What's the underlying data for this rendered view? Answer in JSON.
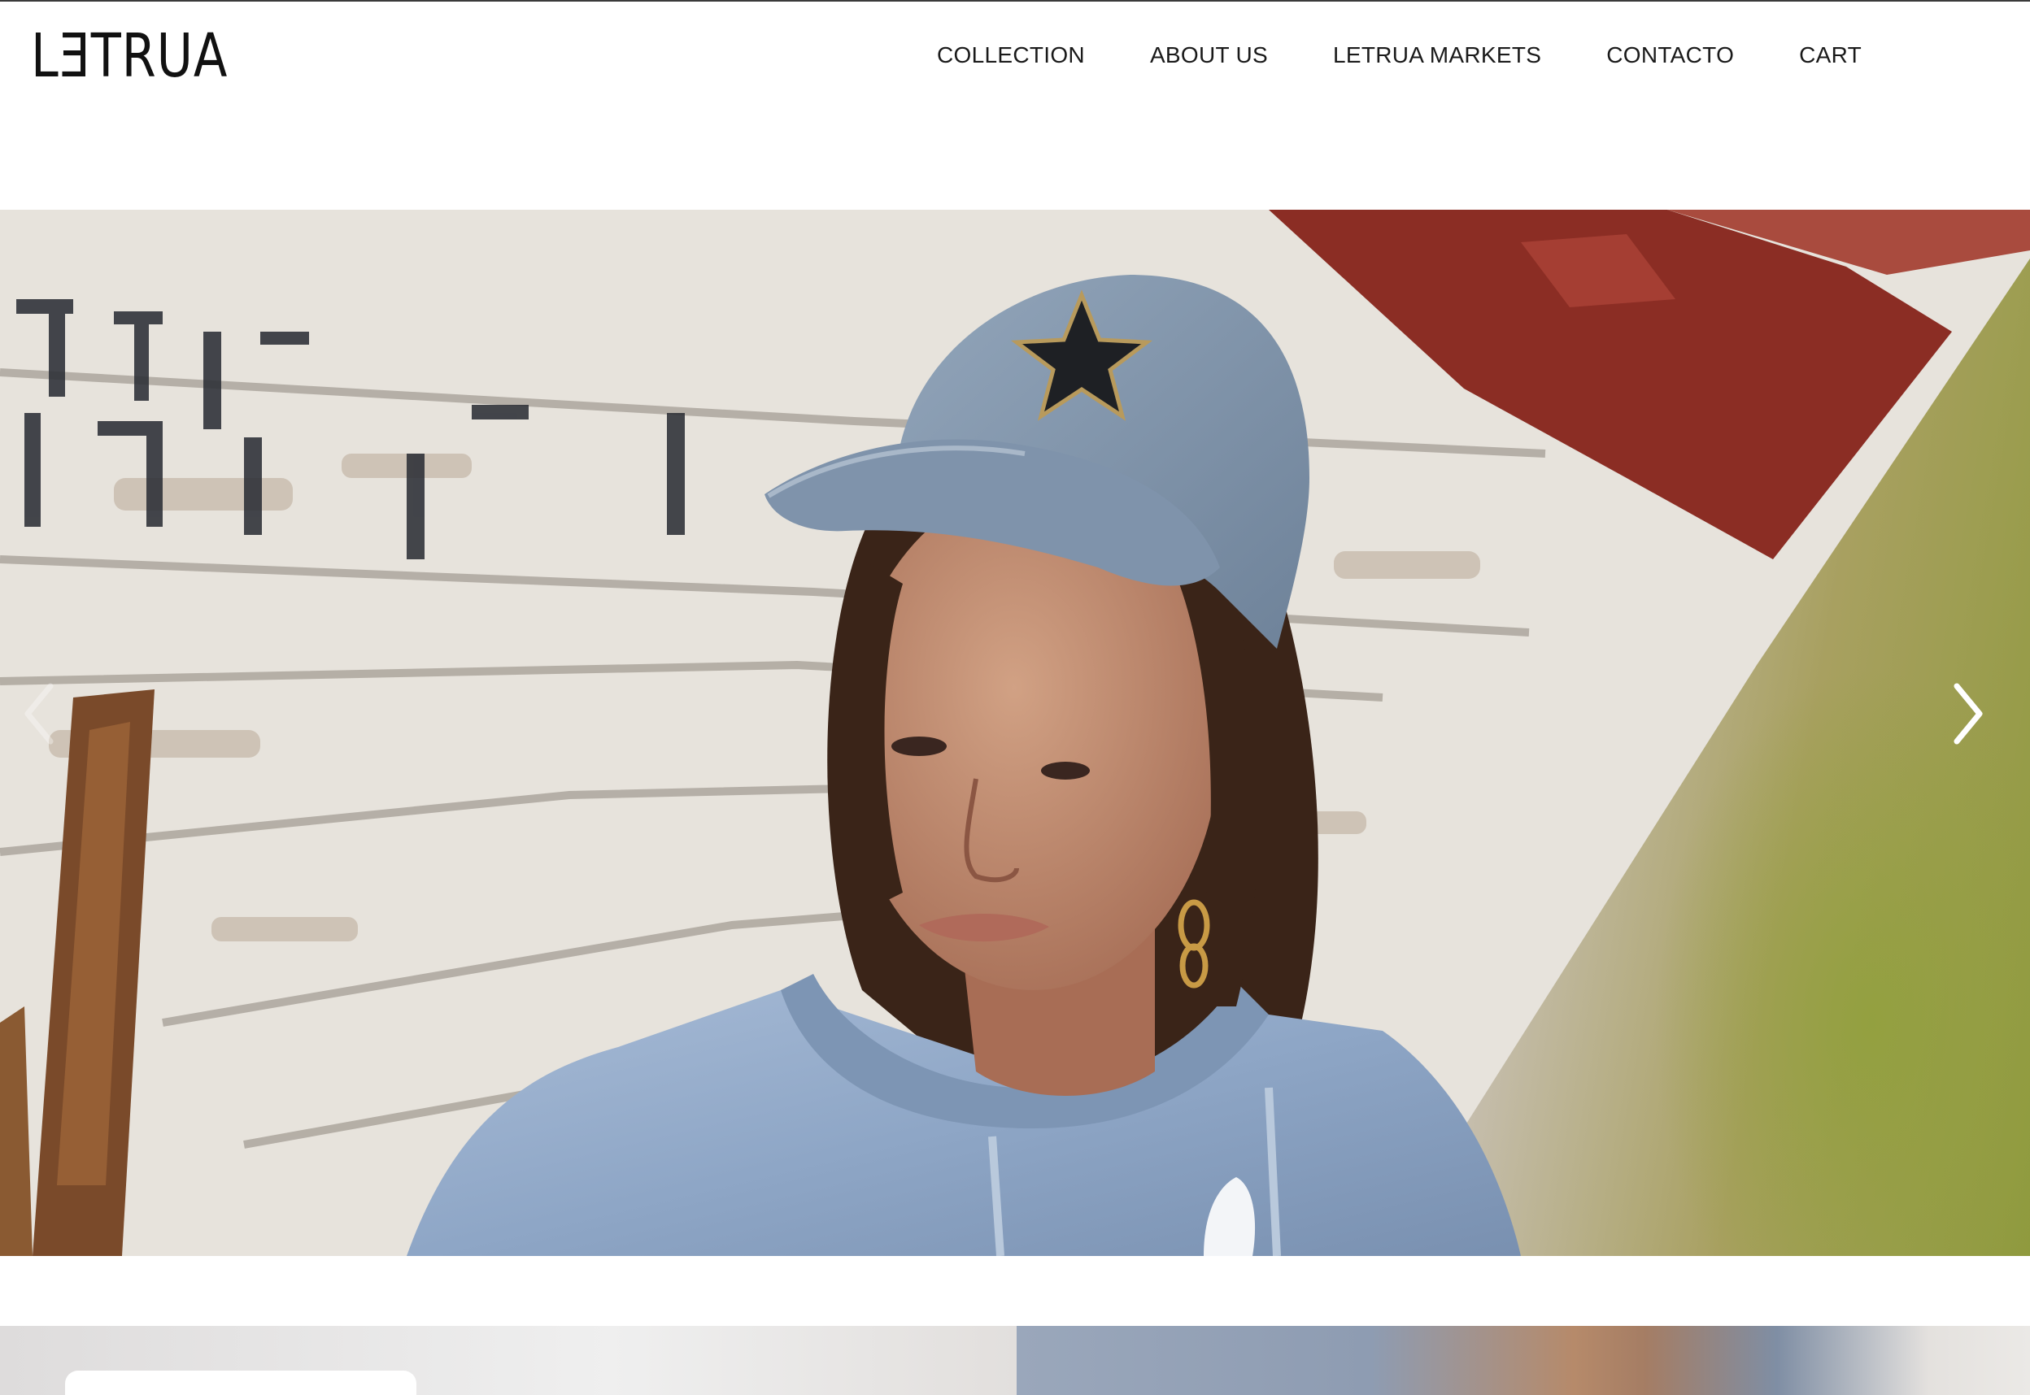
{
  "header": {
    "logo": "LƎTRUA",
    "nav": {
      "collection": "COLLECTION",
      "about": "ABOUT US",
      "markets": "LETRUA MARKETS",
      "contact": "CONTACTO",
      "cart": "CART"
    }
  },
  "hero": {
    "slider_prev_icon": "chevron-left-icon",
    "slider_next_icon": "chevron-right-icon"
  },
  "colors": {
    "text": "#1a1a1a",
    "cap": "#7d91a8",
    "hoodie": "#8fa6c4",
    "boat_red": "#8a2a22"
  }
}
